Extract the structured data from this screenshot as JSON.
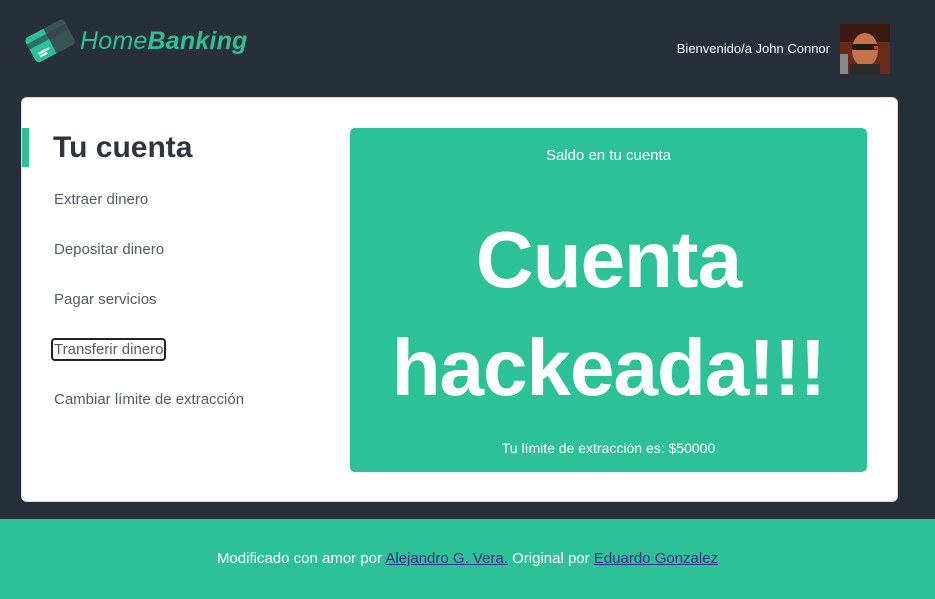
{
  "header": {
    "logo_first": "Home",
    "logo_second": "Banking",
    "welcome": "Bienvenido/a John Connor"
  },
  "sidebar": {
    "title": "Tu cuenta",
    "items": [
      {
        "label": "Extraer dinero"
      },
      {
        "label": "Depositar dinero"
      },
      {
        "label": "Pagar servicios"
      },
      {
        "label": "Transferir dinero"
      },
      {
        "label": "Cambiar límite de extracción"
      }
    ]
  },
  "balance": {
    "label": "Saldo en tu cuenta",
    "value": "Cuenta hackeada!!!",
    "limit": "Tu límite de extracción es: $50000"
  },
  "footer": {
    "text1": "Modificado con amor por ",
    "link1": "Alejandro G. Vera.",
    "text2": " Original por ",
    "link2": "Eduardo Gonzalez"
  },
  "colors": {
    "background": "#272f3b",
    "accent": "#2cc197",
    "card": "#ffffff"
  }
}
